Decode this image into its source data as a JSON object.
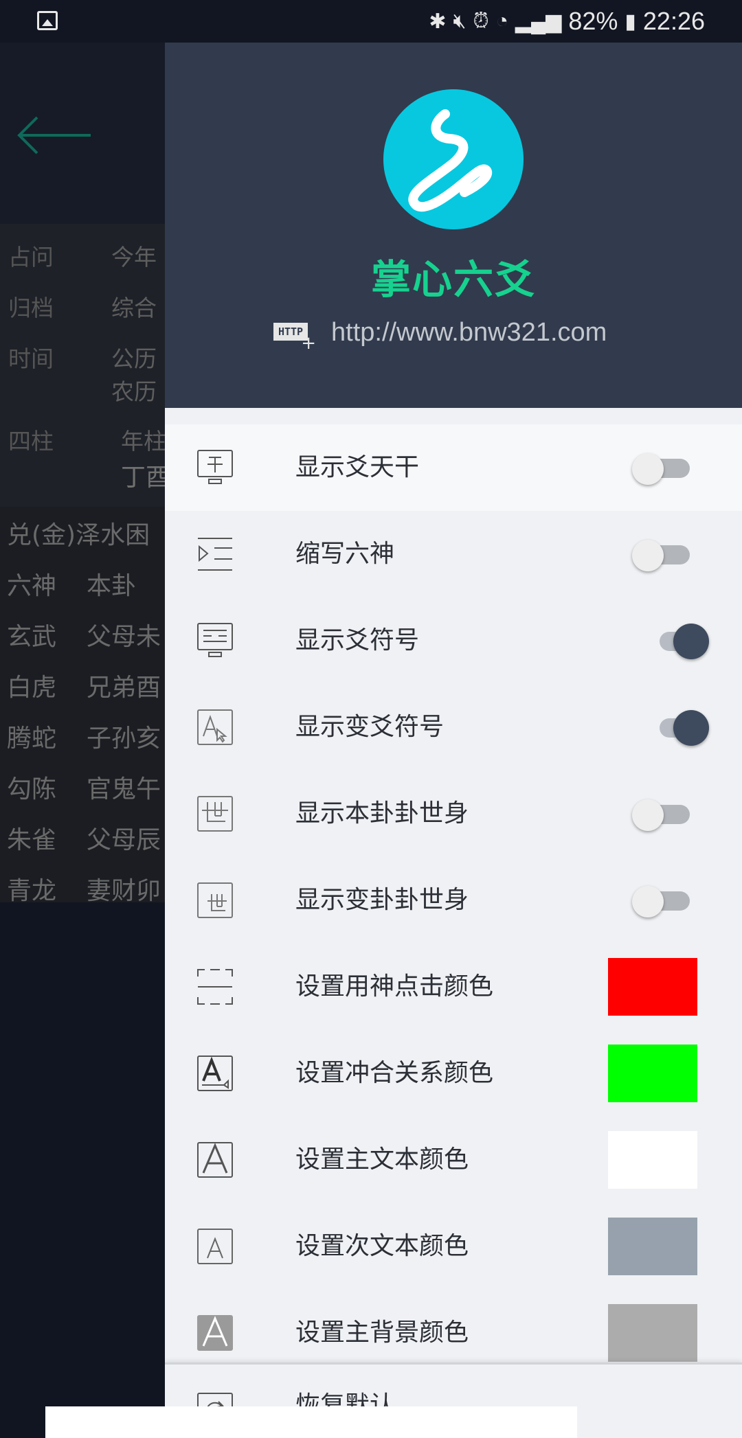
{
  "status_bar": {
    "battery": "82%",
    "time": "22:26"
  },
  "background_app": {
    "info_rows": [
      {
        "label": "占问",
        "value": "今年"
      },
      {
        "label": "归档",
        "value": "综合"
      },
      {
        "label": "时间",
        "value": "公历"
      },
      {
        "label": "",
        "value": "农历"
      },
      {
        "label": "四柱",
        "value": "年柱"
      },
      {
        "label": "",
        "value": "丁酉"
      }
    ],
    "hexagram_title": "兑(金)泽水困",
    "table_header": [
      "六神",
      "本卦"
    ],
    "table_rows": [
      [
        "玄武",
        "父母未"
      ],
      [
        "白虎",
        "兄弟酉"
      ],
      [
        "腾蛇",
        "子孙亥"
      ],
      [
        "勾陈",
        "官鬼午"
      ],
      [
        "朱雀",
        "父母辰"
      ],
      [
        "青龙",
        "妻财卯"
      ]
    ]
  },
  "drawer": {
    "app_name": "掌心六爻",
    "http_badge": "HTTP",
    "url": "http://www.bnw321.com",
    "settings": [
      {
        "label": "显示爻天干",
        "type": "toggle",
        "on": false,
        "icon": "gan-monitor-icon"
      },
      {
        "label": "缩写六神",
        "type": "toggle",
        "on": false,
        "icon": "indent-list-icon"
      },
      {
        "label": "显示爻符号",
        "type": "toggle",
        "on": true,
        "icon": "symbol-monitor-icon"
      },
      {
        "label": "显示变爻符号",
        "type": "toggle",
        "on": true,
        "icon": "font-cursor-icon"
      },
      {
        "label": "显示本卦卦世身",
        "type": "toggle",
        "on": false,
        "icon": "shi-box-icon"
      },
      {
        "label": "显示变卦卦世身",
        "type": "toggle",
        "on": false,
        "icon": "shi-small-box-icon"
      },
      {
        "label": "设置用神点击颜色",
        "type": "color",
        "color": "#ff0000",
        "icon": "frame-corners-icon"
      },
      {
        "label": "设置冲合关系颜色",
        "type": "color",
        "color": "#00ff00",
        "icon": "font-fill-icon"
      },
      {
        "label": "设置主文本颜色",
        "type": "color",
        "color": "#ffffff",
        "icon": "font-large-icon"
      },
      {
        "label": "设置次文本颜色",
        "type": "color",
        "color": "#97a1ad",
        "icon": "font-small-icon"
      },
      {
        "label": "设置主背景颜色",
        "type": "color",
        "color": "#acacac",
        "icon": "font-filled-icon"
      }
    ],
    "restore_label": "恢复默认"
  }
}
